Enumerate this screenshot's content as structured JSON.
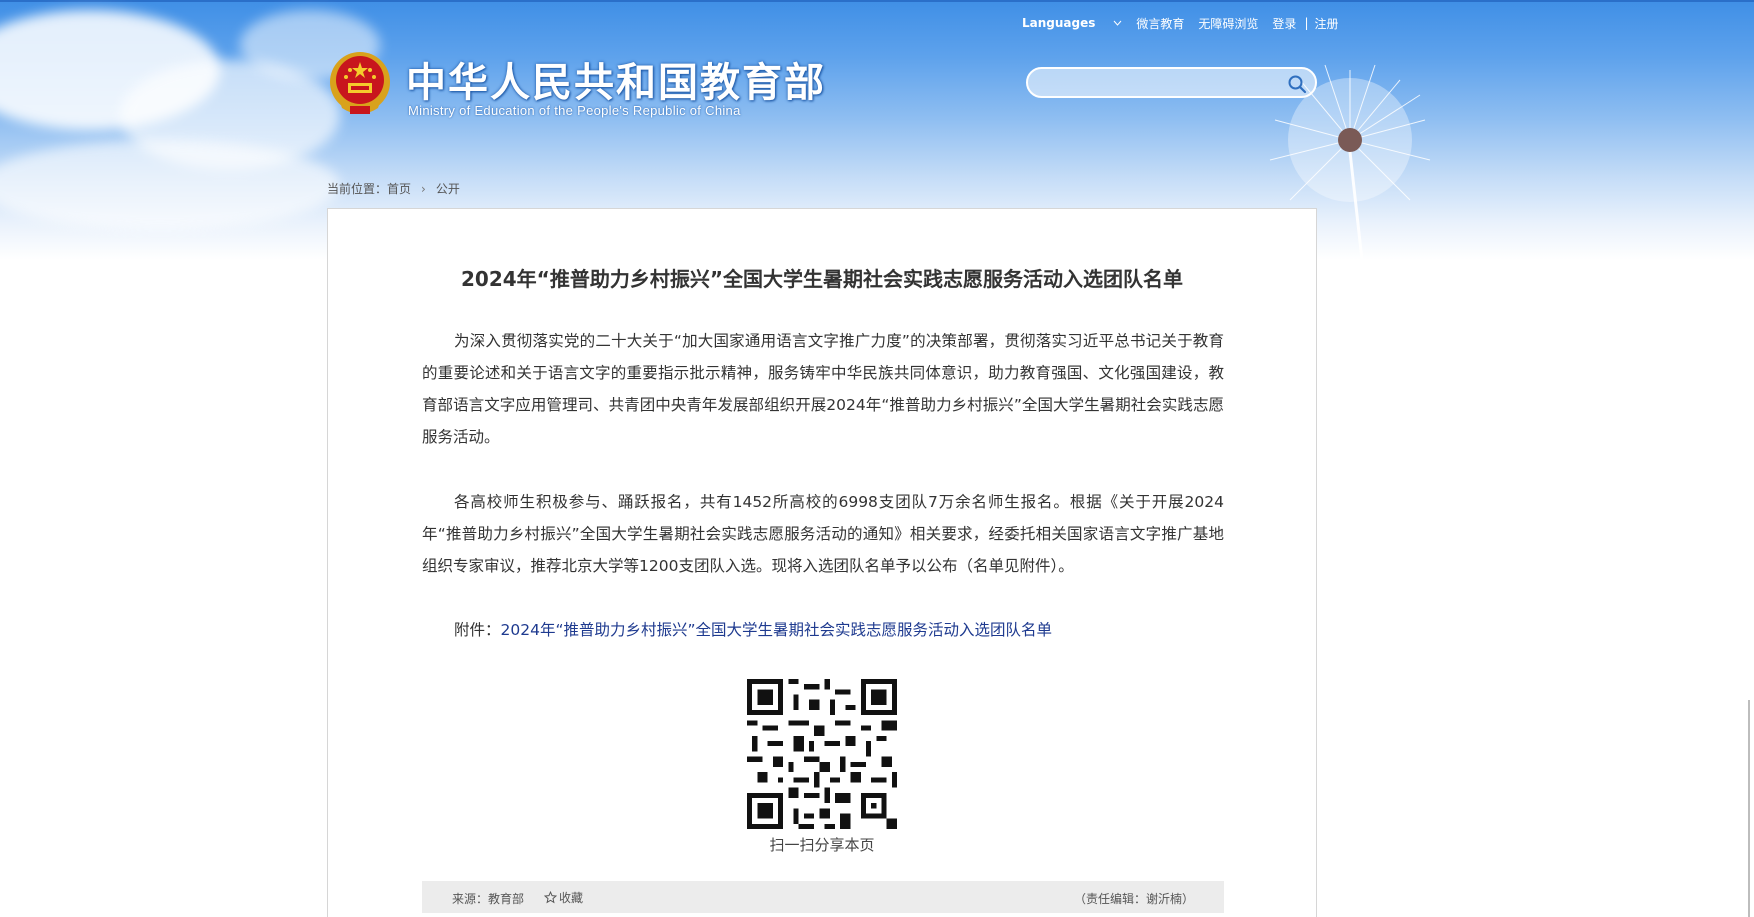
{
  "header": {
    "title": "中华人民共和国教育部",
    "subtitle": "Ministry of Education of the People's Republic of China",
    "top_links": {
      "languages": "Languages",
      "weiyan": "微言教育",
      "accessibility": "无障碍浏览",
      "login": "登录",
      "separator": "|",
      "register": "注册"
    },
    "search": {
      "placeholder": "",
      "value": ""
    }
  },
  "breadcrumb": {
    "prefix": "当前位置：",
    "home": "首页",
    "current": "公开"
  },
  "article": {
    "title": "2024年“推普助力乡村振兴”全国大学生暑期社会实践志愿服务活动入选团队名单",
    "paragraphs": [
      "为深入贯彻落实党的二十大关于“加大国家通用语言文字推广力度”的决策部署，贯彻落实习近平总书记关于教育的重要论述和关于语言文字的重要指示批示精神，服务铸牢中华民族共同体意识，助力教育强国、文化强国建设，教育部语言文字应用管理司、共青团中央青年发展部组织开展2024年“推普助力乡村振兴”全国大学生暑期社会实践志愿服务活动。",
      "各高校师生积极参与、踊跃报名，共有1452所高校的6998支团队7万余名师生报名。根据《关于开展2024年“推普助力乡村振兴”全国大学生暑期社会实践志愿服务活动的通知》相关要求，经委托相关国家语言文字推广基地组织专家审议，推荐北京大学等1200支团队入选。现将入选团队名单予以公布（名单见附件）。"
    ],
    "attachment_label": "附件：",
    "attachment_link": "2024年“推普助力乡村振兴”全国大学生暑期社会实践志愿服务活动入选团队名单",
    "qr_caption": "扫一扫分享本页",
    "footer": {
      "source": "来源：教育部",
      "favorite": "收藏",
      "editor": "（责任编辑：谢沂楠）"
    }
  },
  "colors": {
    "link": "#1e3a8f",
    "banner_top": "#3f8fe6",
    "footer_bar": "#ececec"
  }
}
